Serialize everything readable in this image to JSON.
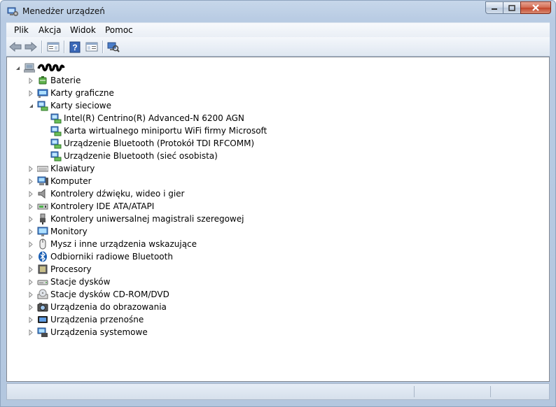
{
  "window": {
    "title": "Menedżer urządzeń"
  },
  "menu": [
    "Plik",
    "Akcja",
    "Widok",
    "Pomoc"
  ],
  "toolbar": {
    "buttons": [
      "back-arrow-icon",
      "forward-arrow-icon",
      "properties-icon",
      "help-icon",
      "view-icon",
      "scan-hardware-icon"
    ]
  },
  "tree": {
    "root": {
      "label": "",
      "expanded": true
    },
    "categories": [
      {
        "label": "Baterie",
        "icon": "battery-icon",
        "expanded": false
      },
      {
        "label": "Karty graficzne",
        "icon": "display-adapter-icon",
        "expanded": false
      },
      {
        "label": "Karty sieciowe",
        "icon": "network-adapter-icon",
        "expanded": true,
        "children": [
          "Intel(R) Centrino(R) Advanced-N 6200 AGN",
          "Karta wirtualnego miniportu WiFi firmy Microsoft",
          "Urządzenie Bluetooth (Protokół TDI RFCOMM)",
          "Urządzenie Bluetooth (sieć osobista)"
        ]
      },
      {
        "label": "Klawiatury",
        "icon": "keyboard-icon",
        "expanded": false
      },
      {
        "label": "Komputer",
        "icon": "computer-icon",
        "expanded": false
      },
      {
        "label": "Kontrolery dźwięku, wideo i gier",
        "icon": "speaker-icon",
        "expanded": false
      },
      {
        "label": "Kontrolery IDE ATA/ATAPI",
        "icon": "ide-controller-icon",
        "expanded": false
      },
      {
        "label": "Kontrolery uniwersalnej magistrali szeregowej",
        "icon": "usb-icon",
        "expanded": false
      },
      {
        "label": "Monitory",
        "icon": "monitor-icon",
        "expanded": false
      },
      {
        "label": "Mysz i inne urządzenia wskazujące",
        "icon": "mouse-icon",
        "expanded": false
      },
      {
        "label": "Odbiorniki radiowe Bluetooth",
        "icon": "bluetooth-icon",
        "expanded": false
      },
      {
        "label": "Procesory",
        "icon": "processor-icon",
        "expanded": false
      },
      {
        "label": "Stacje dysków",
        "icon": "disk-drive-icon",
        "expanded": false
      },
      {
        "label": "Stacje dysków CD-ROM/DVD",
        "icon": "cdrom-icon",
        "expanded": false
      },
      {
        "label": "Urządzenia do obrazowania",
        "icon": "camera-icon",
        "expanded": false
      },
      {
        "label": "Urządzenia przenośne",
        "icon": "portable-device-icon",
        "expanded": false
      },
      {
        "label": "Urządzenia systemowe",
        "icon": "system-device-icon",
        "expanded": false
      }
    ]
  },
  "colors": {
    "titlebar": "#b9cde4",
    "close_button": "#c7482d",
    "tree_bg": "#ffffff"
  }
}
